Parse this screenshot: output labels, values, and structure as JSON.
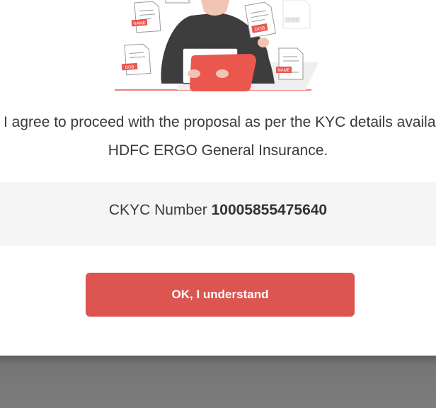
{
  "illustration": {
    "doc_tags": [
      "NAME",
      "DOB",
      "NAME",
      "DOB",
      "NAME",
      "NAME"
    ],
    "icon": "kyc-documents-illustration",
    "accent_color": "#e9574f"
  },
  "consent": {
    "line1": "I agree to proceed with the proposal as per the KYC details available with",
    "line2": "HDFC ERGO General Insurance."
  },
  "ckyc": {
    "label": "CKYC Number ",
    "number": "10005855475640"
  },
  "actions": {
    "ok_label": "OK, I understand",
    "button_color": "#dc5550"
  }
}
